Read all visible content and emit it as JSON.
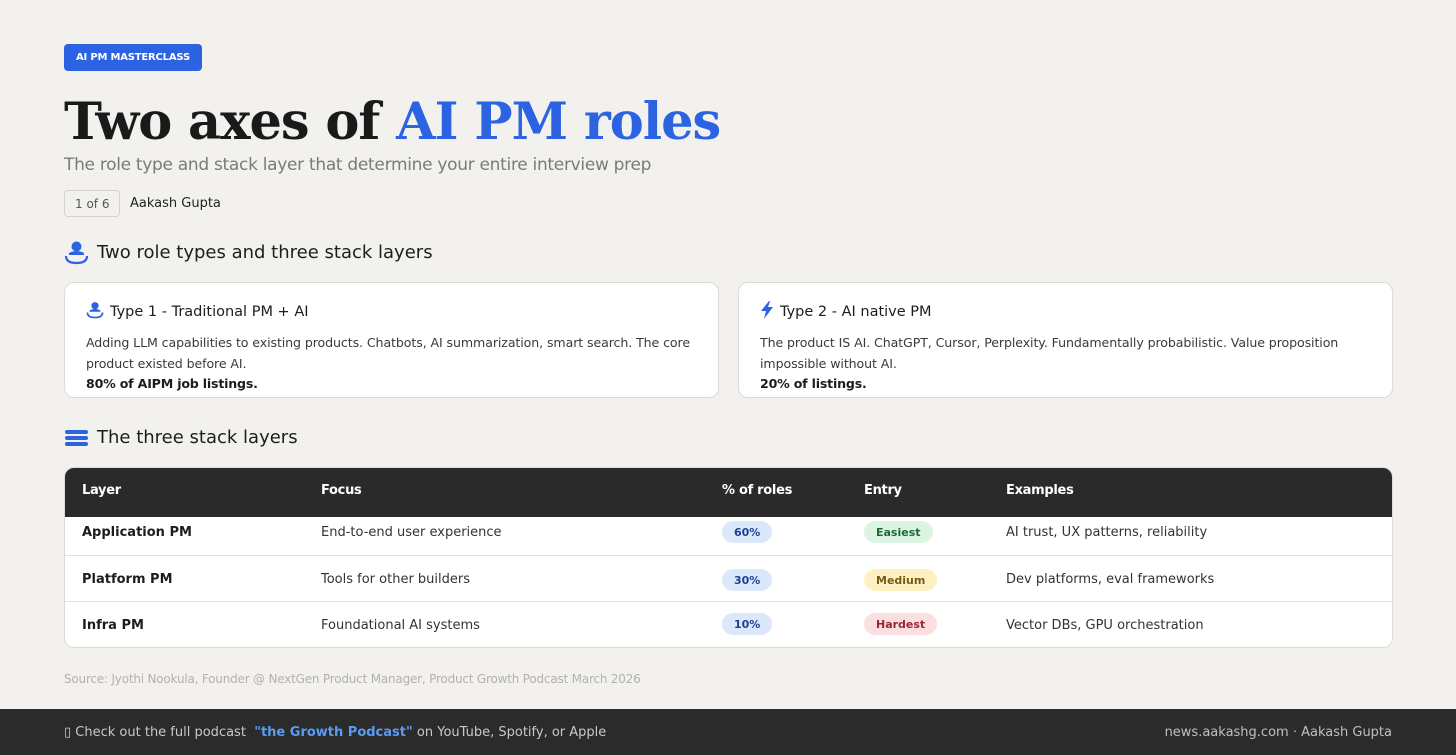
{
  "badge": "AI PM MASTERCLASS",
  "title": {
    "main": "Two axes of ",
    "accent": "AI PM roles"
  },
  "subtitle": "The role type and stack layer that determine your entire interview prep",
  "page_indicator": "1 of 6",
  "author": "Aakash Gupta",
  "section1": {
    "heading": "Two role types and three stack layers",
    "icon": "user-ring-icon"
  },
  "cards": [
    {
      "icon": "user-ring-icon",
      "title": "Type 1 - Traditional PM + AI",
      "desc": "Adding LLM capabilities to existing products. Chatbots, AI summarization, smart search. The core product existed before AI.",
      "stat": "80% of AIPM job listings."
    },
    {
      "icon": "lightning-icon",
      "title": "Type 2 - AI native PM",
      "desc": "The product IS AI. ChatGPT, Cursor, Perplexity. Fundamentally probabilistic. Value proposition impossible without AI.",
      "stat": "20% of listings."
    }
  ],
  "section2": {
    "heading": "The three stack layers",
    "icon": "stack-layers-icon"
  },
  "table": {
    "headers": [
      "Layer",
      "Focus",
      "% of roles",
      "Entry",
      "Examples"
    ],
    "rows": [
      {
        "layer": "Application PM",
        "focus": "End-to-end user experience",
        "pct": "60%",
        "entry": "Easiest",
        "examples": "AI trust, UX patterns, reliability"
      },
      {
        "layer": "Platform PM",
        "focus": "Tools for other builders",
        "pct": "30%",
        "entry": "Medium",
        "examples": "Dev platforms, eval frameworks"
      },
      {
        "layer": "Infra PM",
        "focus": "Foundational AI systems",
        "pct": "10%",
        "entry": "Hardest",
        "examples": "Vector DBs, GPU orchestration"
      }
    ]
  },
  "source": "Source: Jyothi Nookula, Founder @ NextGen Product Manager, Product Growth Podcast March 2026",
  "footer": {
    "icon_glyph": "▯",
    "prefix": "Check out the full podcast",
    "podcast": "\"the Growth Podcast\"",
    "suffix": "on YouTube, Spotify, or Apple",
    "right": "news.aakashg.com · Aakash Gupta"
  },
  "colors": {
    "accent": "#2b63e2",
    "pct_pill_bg": "#dbe8fb",
    "pct_pill_text": "#1f3f8f",
    "easiest_bg": "#dcf5e3",
    "easiest_text": "#1b6a36",
    "medium_bg": "#fdf1c4",
    "medium_text": "#7a5a10",
    "hardest_bg": "#fbdfe0",
    "hardest_text": "#9a2630"
  }
}
